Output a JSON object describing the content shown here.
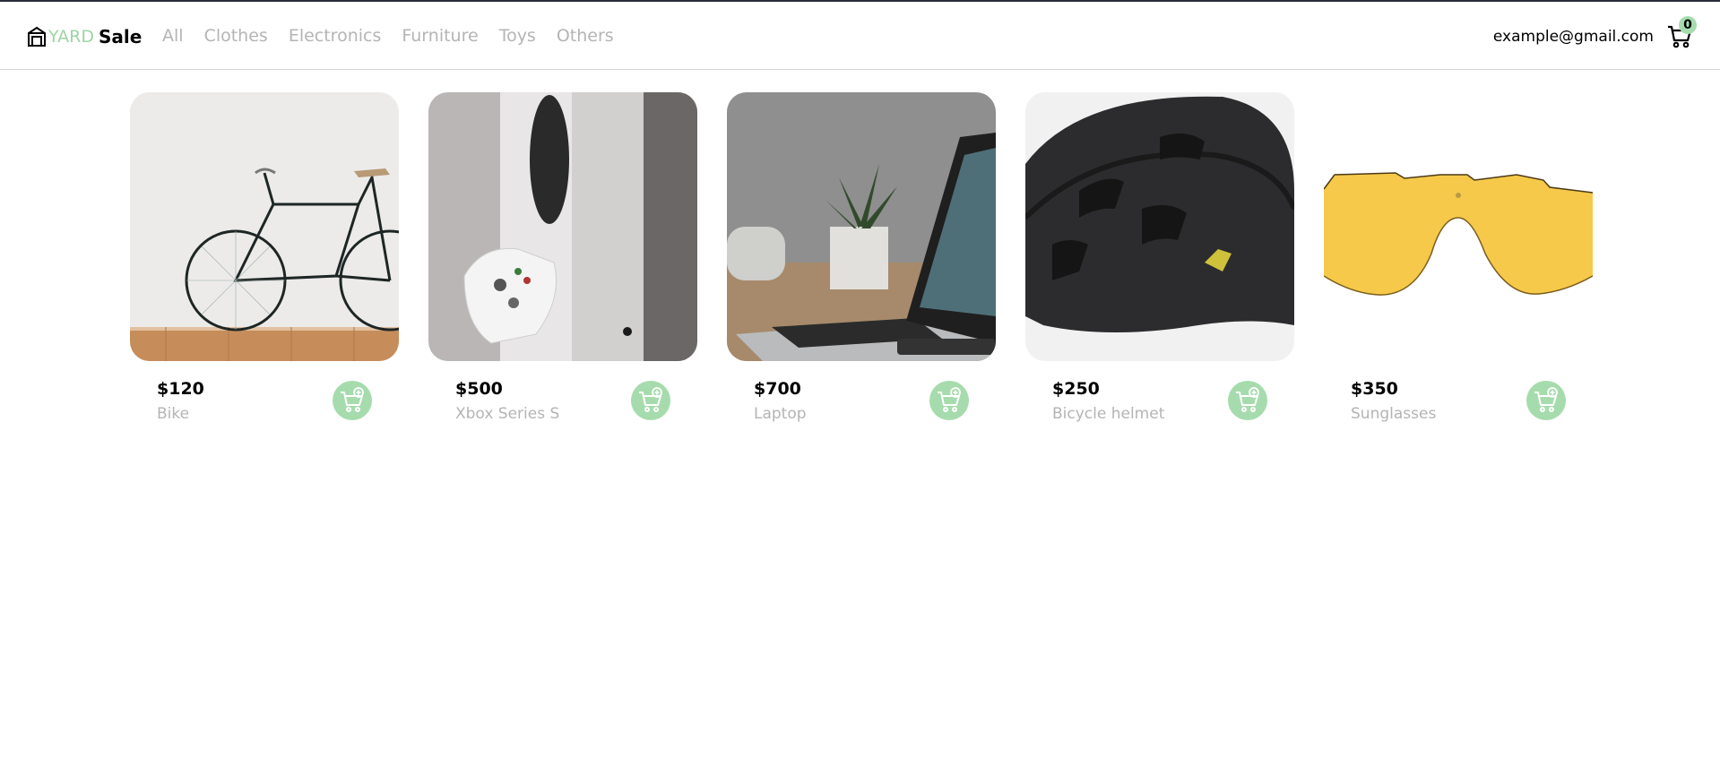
{
  "header": {
    "logo_yard": "YARD",
    "logo_sale": "Sale",
    "nav": [
      "All",
      "Clothes",
      "Electronics",
      "Furniture",
      "Toys",
      "Others"
    ],
    "user_email": "example@gmail.com",
    "cart_count": "0"
  },
  "products": [
    {
      "price": "$120",
      "name": "Bike",
      "image": "bicycle against white wall on wooden floor"
    },
    {
      "price": "$500",
      "name": "Xbox Series S",
      "image": "white game console with controller"
    },
    {
      "price": "$700",
      "name": "Laptop",
      "image": "laptop on desk with plant and cup"
    },
    {
      "price": "$250",
      "name": "Bicycle helmet",
      "image": "black bicycle helmet"
    },
    {
      "price": "$350",
      "name": "Sunglasses",
      "image": "yellow sports sunglasses lens"
    }
  ],
  "colors": {
    "accent": "#a6dcad",
    "logo_green": "#9fd4a6",
    "muted_text": "#b4b4b4",
    "top_border": "#2b2d3a"
  },
  "icons": [
    "storefront-icon",
    "shopping-cart-icon",
    "add-to-cart-icon"
  ]
}
